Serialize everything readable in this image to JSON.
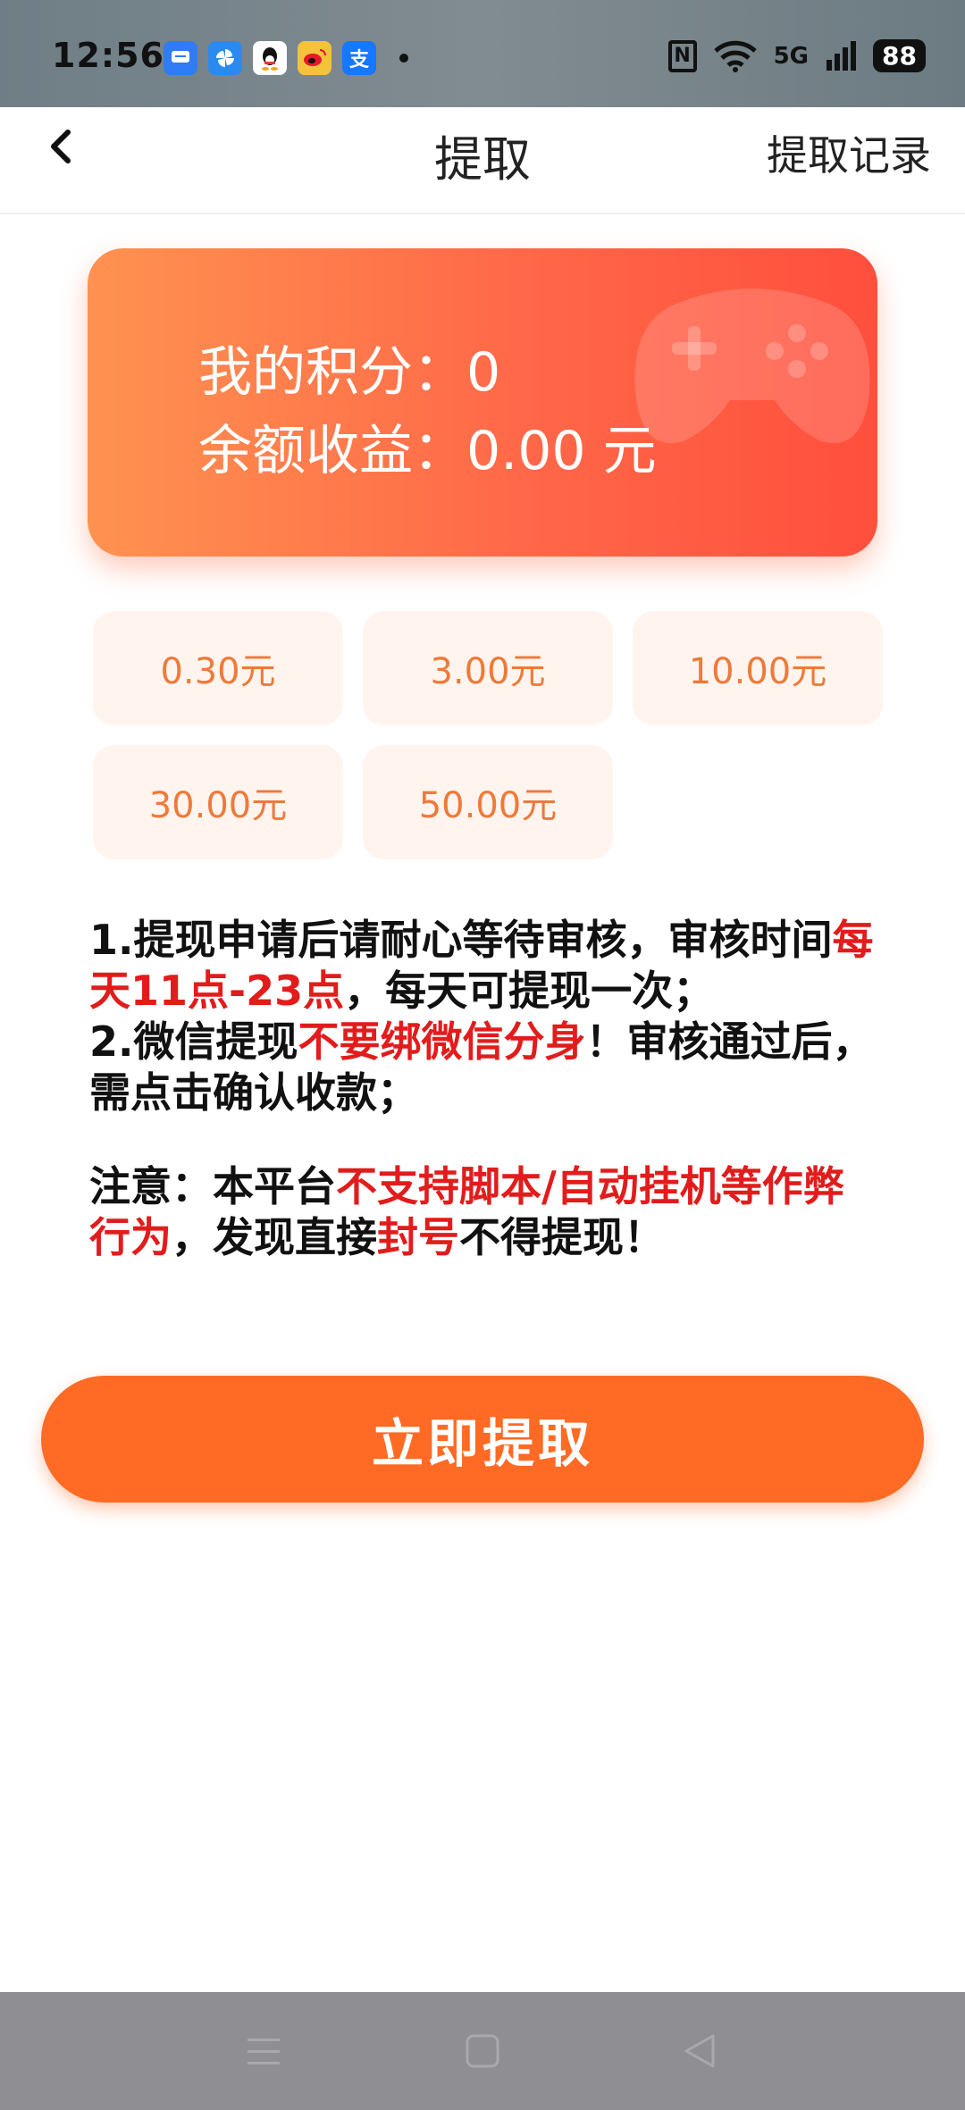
{
  "status_bar": {
    "time": "12:56",
    "app_icons": [
      {
        "name": "message-icon",
        "color": "#2f7cf6",
        "glyph": "▬"
      },
      {
        "name": "pinwheel-icon",
        "color": "#2b8af0",
        "glyph": "✿"
      },
      {
        "name": "qq-icon",
        "color": "#ffffff",
        "glyph": "●"
      },
      {
        "name": "weibo-icon",
        "color": "#f5c33b",
        "glyph": "◉"
      },
      {
        "name": "alipay-icon",
        "color": "#1677ff",
        "glyph": "支"
      }
    ],
    "network": "5G",
    "battery": "88"
  },
  "header": {
    "title": "提取",
    "records_label": "提取记录"
  },
  "card": {
    "points_label": "我的积分：",
    "points_value": "0",
    "balance_label": "余额收益：",
    "balance_value": "0.00 元"
  },
  "amount_options": [
    "0.30元",
    "3.00元",
    "10.00元",
    "30.00元",
    "50.00元"
  ],
  "notice": {
    "line1_a": "1.提现申请后请耐心等待审核，审核时间",
    "line1_red": "每天11点-23点",
    "line1_b": "，每天可提现一次；",
    "line2_a": "2.微信提现",
    "line2_red": "不要绑微信分身",
    "line2_b": "！审核通过后，需点击确认收款；",
    "note_a": "注意：本平台",
    "note_red1": "不支持脚本/自动挂机等作弊行为",
    "note_b": "，发现直接",
    "note_red2": "封号",
    "note_c": "不得提现！"
  },
  "submit_label": "立即提取",
  "colors": {
    "accent": "#ff6a24",
    "card_start": "#ff9250",
    "card_end": "#ff4f3d",
    "option_bg": "#fff4ee",
    "option_text": "#ee7a3a",
    "warning_red": "#e21c1c"
  }
}
